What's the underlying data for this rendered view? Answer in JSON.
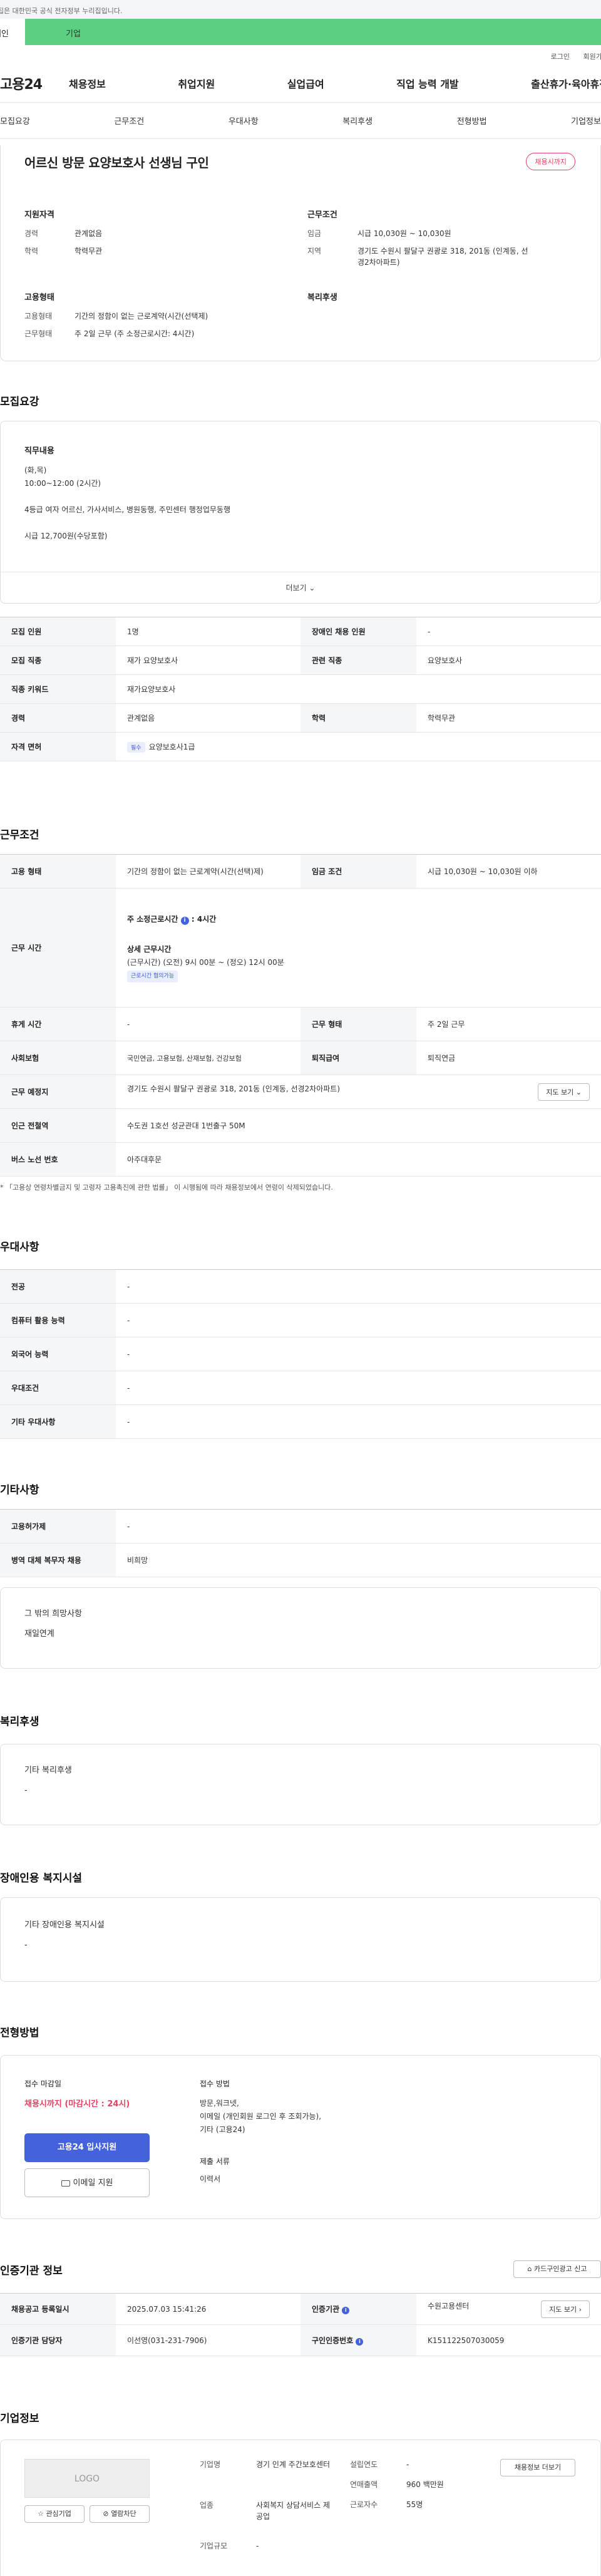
{
  "topbar": {
    "notice": "이 누리집은 대한민국 공식 전자정부 누리집입니다."
  },
  "catbar": {
    "left": "개인",
    "right": "기업"
  },
  "util": {
    "login": "로그인",
    "signup": "회원가입"
  },
  "gnb": {
    "logo": "고용24",
    "menu": [
      "채용정보",
      "취업지원",
      "실업급여",
      "직업 능력 개발",
      "출산휴가·육아휴직"
    ]
  },
  "subtabs": [
    "모집요강",
    "근무조건",
    "우대사항",
    "복리후생",
    "전형방법",
    "기업정보"
  ],
  "summary": {
    "title": "어르신 방문 요양보호사 선생님 구인",
    "deadline_badge": "채용시까지",
    "support_title": "지원자격",
    "career_k": "경력",
    "career_v": "관계없음",
    "edu_k": "학력",
    "edu_v": "학력무관",
    "cond_title": "근무조건",
    "wage_k": "임금",
    "wage_v": "시급 10,030원 ~ 10,030원",
    "region_k": "지역",
    "region_v": "경기도 수원시 팔달구 권광로 318, 201동 (인계동, 선경2차아파트)",
    "emp_title": "고용형태",
    "emp_k": "고용형태",
    "emp_v": "기간의 정함이 없는 근로계약(시간(선택제)",
    "shift_k": "근무형태",
    "shift_v": "주 2일 근무 (주 소정근로시간: 4시간)",
    "welfare_title": "복리후생"
  },
  "recruit": {
    "section": "모집요강",
    "duty_title": "직무내용",
    "duty_lines": [
      "(화,목)",
      "10:00~12:00 (2시간)",
      "",
      "4등급  여자 어르신, 가사서비스, 병원동행, 주민센터 행정업무동행",
      "",
      "시급 12,700원(수당포함)"
    ],
    "more": "더보기 ⌄",
    "rows": {
      "r1": {
        "k1": "모집 인원",
        "v1": "1명",
        "k2": "장애인 채용 인원",
        "v2": "-"
      },
      "r2": {
        "k1": "모집 직종",
        "v1": "재가 요양보호사",
        "k2": "관련 직종",
        "v2": "요양보호사"
      },
      "r3": {
        "k1": "직종 키워드",
        "v1": "재가요양보호사"
      },
      "r4": {
        "k1": "경력",
        "v1": "관계없음",
        "k2": "학력",
        "v2": "학력무관"
      },
      "r5": {
        "k1": "자격 면허",
        "tag": "필수",
        "v1": "요양보호사1급"
      }
    }
  },
  "work": {
    "section": "근무조건",
    "emp_k": "고용 형태",
    "emp_v": "기간의 정함이 없는 근로계약(시간(선택)제)",
    "wage_k": "임금 조건",
    "wage_v": "시급 10,030원 ~ 10,030원 이하",
    "time_k": "근무 시간",
    "time_weekly": "주 소정근로시간",
    "time_weekly_v": ": 4시간",
    "time_detail_title": "상세 근무시간",
    "time_detail": "(근무시간) (오전) 9시 00분 ~ (정오) 12시 00분",
    "time_tag": "근로시간 협의가능",
    "rest_k": "휴게 시간",
    "rest_v": "-",
    "shift_k": "근무 형태",
    "shift_v": "주 2일 근무",
    "ins_k": "사회보험",
    "ins_v": "국민연금, 고용보험, 산재보험, 건강보험",
    "ret_k": "퇴직급여",
    "ret_v": "퇴직연금",
    "loc_k": "근무 예정지",
    "loc_v": "경기도 수원시 팔달구 권광로 318, 201동 (인계동, 선경2차아파트)",
    "map_btn": "지도 보기 ⌄",
    "sub_k": "인근 전철역",
    "sub_v": "수도권 1호선 성균관대 1번출구 50M",
    "bus_k": "버스 노선 번호",
    "bus_v": "아주대후문",
    "note": "* 「고용상 연령차별금지 및 고령자 고용촉진에 관한 법률」 이 시행됨에 따라 채용정보에서 연령이 삭제되었습니다."
  },
  "pref": {
    "section": "우대사항",
    "rows": [
      {
        "k": "전공",
        "v": "-"
      },
      {
        "k": "컴퓨터 활용 능력",
        "v": "-"
      },
      {
        "k": "외국어 능력",
        "v": "-"
      },
      {
        "k": "우대조건",
        "v": "-"
      },
      {
        "k": "기타 우대사항",
        "v": "-"
      }
    ]
  },
  "etc": {
    "section": "기타사항",
    "rows": [
      {
        "k": "고용허가제",
        "v": "-"
      },
      {
        "k": "병역 대체 복무자 채용",
        "v": "비희망"
      }
    ],
    "box_title": "그 밖의 희망사항",
    "box_v": "재일연계"
  },
  "welfare": {
    "section": "복리후생",
    "box_title": "기타 복리후생",
    "box_v": "-"
  },
  "disabled": {
    "section": "장애인용 복지시설",
    "box_title": "기타 장애인용 복지시설",
    "box_v": "-"
  },
  "method": {
    "section": "전형방법",
    "deadline_k": "접수 마감일",
    "deadline_v": "채용시까지 (마감시간 : 24시)",
    "apply_btn": "고용24 입사지원",
    "email_btn": "이메일 지원",
    "method_k": "접수 방법",
    "method_lines": [
      "방문,워크넷,",
      "이메일 (개인회원 로그인 후 조회가능),",
      "기타 (고용24)"
    ],
    "docs_k": "제출 서류",
    "docs_v": "이력서"
  },
  "cert": {
    "section": "인증기관 정보",
    "card_btn": "카드구인광고 신고",
    "rows": {
      "reg_k": "채용공고 등록일시",
      "reg_v": "2025.07.03 15:41:26",
      "org_k": "인증기관",
      "org_v": "수원고용센터",
      "map_btn": "지도 보기 ›",
      "mgr_k": "인증기관 담당자",
      "mgr_v": "이선영(031-231-7906)",
      "no_k": "구인인증번호",
      "no_v": "K151122507030059"
    }
  },
  "company": {
    "section": "기업정보",
    "logo": "LOGO",
    "fav_btn": "관심기업",
    "block_btn": "열람차단",
    "name_k": "기업명",
    "name_v": "경기 인계 주간보호센터",
    "ind_k": "업종",
    "ind_v": "사회복지 상담서비스 제공업",
    "size_k": "기업규모",
    "size_v": "-",
    "year_k": "설립연도",
    "year_v": "-",
    "sales_k": "연매출액",
    "sales_v": "960 백만원",
    "emp_k": "근로자수",
    "emp_v": "55명",
    "more_btn": "채용정보 더보기"
  },
  "colors": {
    "accent": "#4462dc",
    "deadline": "#e04463",
    "green": "#5ccf82"
  }
}
